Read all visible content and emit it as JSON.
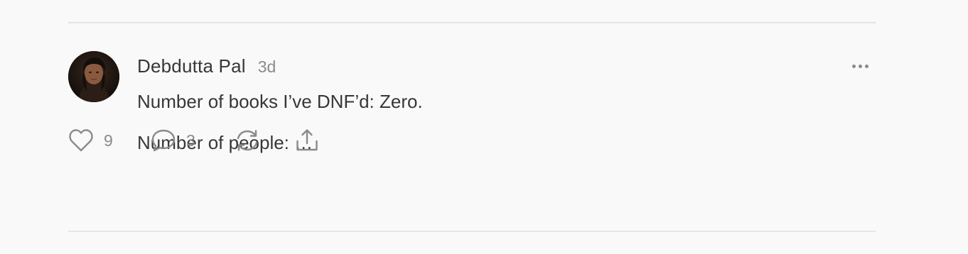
{
  "note": {
    "author": "Debdutta Pal",
    "timestamp": "3d",
    "lines": [
      "Number of books I’ve DNF’d: Zero.",
      "Number of people: …"
    ],
    "likes": "9",
    "comments": "3"
  },
  "icons": {
    "menu": "more-horizontal-icon",
    "like": "heart-icon",
    "comment": "comment-bubble-icon",
    "restack": "restack-icon",
    "share": "share-icon"
  },
  "colors": {
    "background": "#f9f9f9",
    "text": "#363737",
    "muted": "#8a8a8a",
    "divider": "#e6e6e6"
  }
}
